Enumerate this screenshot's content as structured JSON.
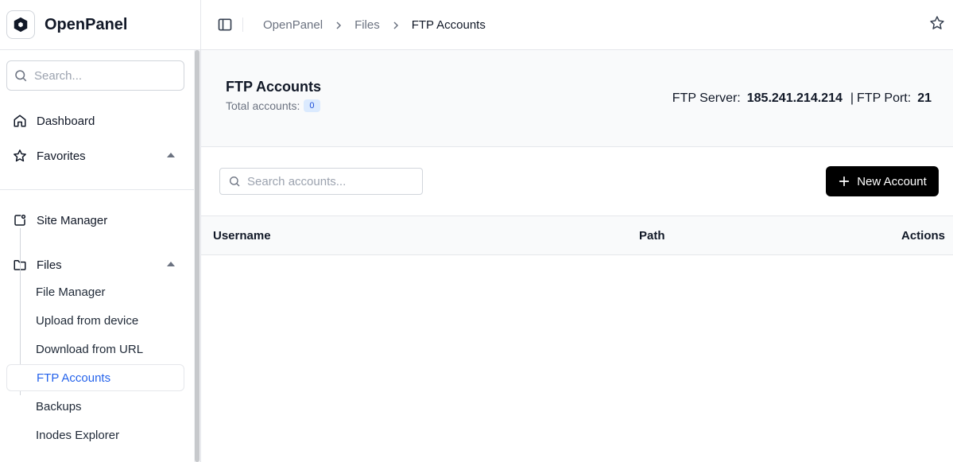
{
  "app": {
    "name": "OpenPanel"
  },
  "sidebar": {
    "search_placeholder": "Search...",
    "items": {
      "dashboard": "Dashboard",
      "favorites": "Favorites",
      "site_manager": "Site Manager",
      "files": "Files"
    },
    "files_submenu": [
      {
        "label": "File Manager",
        "active": false
      },
      {
        "label": "Upload from device",
        "active": false
      },
      {
        "label": "Download from URL",
        "active": false
      },
      {
        "label": "FTP Accounts",
        "active": true
      },
      {
        "label": "Backups",
        "active": false
      },
      {
        "label": "Inodes Explorer",
        "active": false
      }
    ]
  },
  "header": {
    "breadcrumb": [
      "OpenPanel",
      "Files",
      "FTP Accounts"
    ]
  },
  "page": {
    "title": "FTP Accounts",
    "total_label": "Total accounts:",
    "total_count": "0",
    "ftp_server_label": "FTP Server:",
    "ftp_server_value": "185.241.214.214",
    "ftp_port_label": "FTP Port:",
    "ftp_port_value": "21",
    "separator": "|"
  },
  "toolbar": {
    "search_placeholder": "Search accounts...",
    "new_button": "New Account"
  },
  "table": {
    "columns": [
      "Username",
      "Path",
      "Actions"
    ],
    "rows": []
  },
  "colors": {
    "accent": "#2563eb",
    "badge_bg": "#dbeafe",
    "button_bg": "#000000"
  },
  "icons": {
    "logo": "openpanel-logo-icon",
    "dashboard": "home-icon",
    "favorites": "star-icon",
    "site_manager": "site-manager-icon",
    "files": "folder-icon",
    "sidebar_toggle": "sidebar-toggle-icon",
    "bookmark": "star-icon",
    "search": "search-icon",
    "new": "plus-icon"
  }
}
